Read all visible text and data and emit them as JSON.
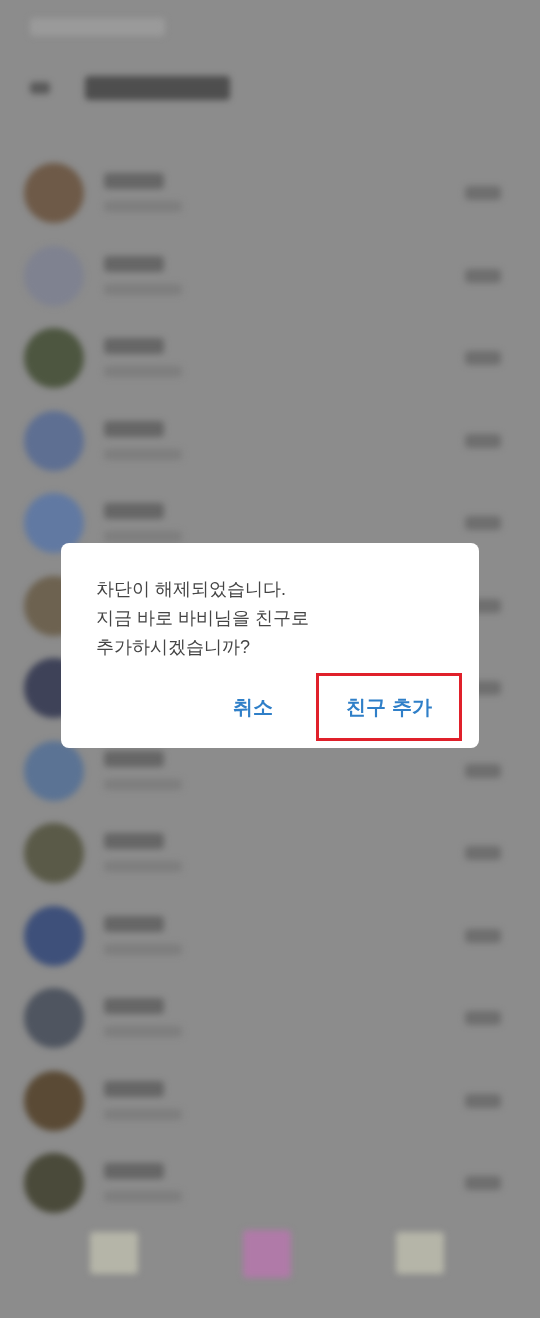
{
  "dialog": {
    "message_lines": [
      "차단이 해제되었습니다.",
      "지금 바로 바비님을 친구로",
      "추가하시겠습니까?"
    ],
    "buttons": [
      {
        "label": "취소",
        "highlighted": false
      },
      {
        "label": "친구 추가",
        "highlighted": true
      }
    ]
  }
}
